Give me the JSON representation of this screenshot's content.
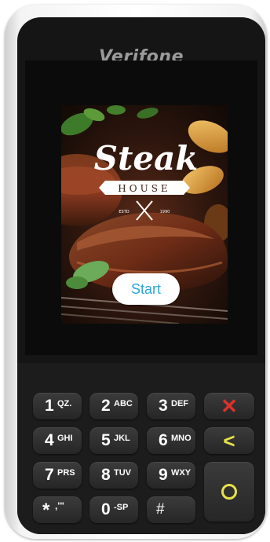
{
  "device": {
    "brand": "Verifone"
  },
  "screen": {
    "logo": {
      "title": "Steak",
      "subtitle": "HOUSE",
      "estd_left": "ESTD",
      "estd_right": "1990"
    },
    "start_button_label": "Start"
  },
  "keypad": {
    "keys": [
      {
        "digit": "1",
        "letters": "QZ."
      },
      {
        "digit": "2",
        "letters": "ABC"
      },
      {
        "digit": "3",
        "letters": "DEF"
      },
      {
        "digit": "4",
        "letters": "GHI"
      },
      {
        "digit": "5",
        "letters": "JKL"
      },
      {
        "digit": "6",
        "letters": "MNO"
      },
      {
        "digit": "7",
        "letters": "PRS"
      },
      {
        "digit": "8",
        "letters": "TUV"
      },
      {
        "digit": "9",
        "letters": "WXY"
      },
      {
        "digit": "*",
        "letters": ",'\""
      },
      {
        "digit": "0",
        "letters": "-SP"
      },
      {
        "digit": "#",
        "letters": ""
      }
    ],
    "cancel_symbol": "✕",
    "clear_symbol": "<",
    "cancel_color": "#e0302a",
    "clear_color": "#e8e24a",
    "enter_color": "#e8e24a"
  }
}
